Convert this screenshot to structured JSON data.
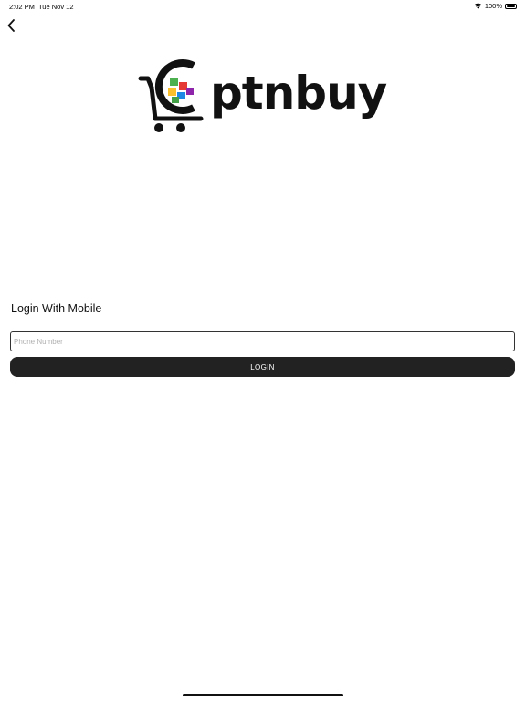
{
  "status_bar": {
    "time": "2:02 PM",
    "date": "Tue Nov 12",
    "battery": "100%"
  },
  "header": {
    "back_icon": "chevron-left-icon"
  },
  "logo": {
    "text": "ptnbuy"
  },
  "login": {
    "title": "Login With Mobile",
    "phone_placeholder": "Phone Number",
    "phone_value": "",
    "button_label": "LOGIN",
    "button_color": "#222222"
  }
}
